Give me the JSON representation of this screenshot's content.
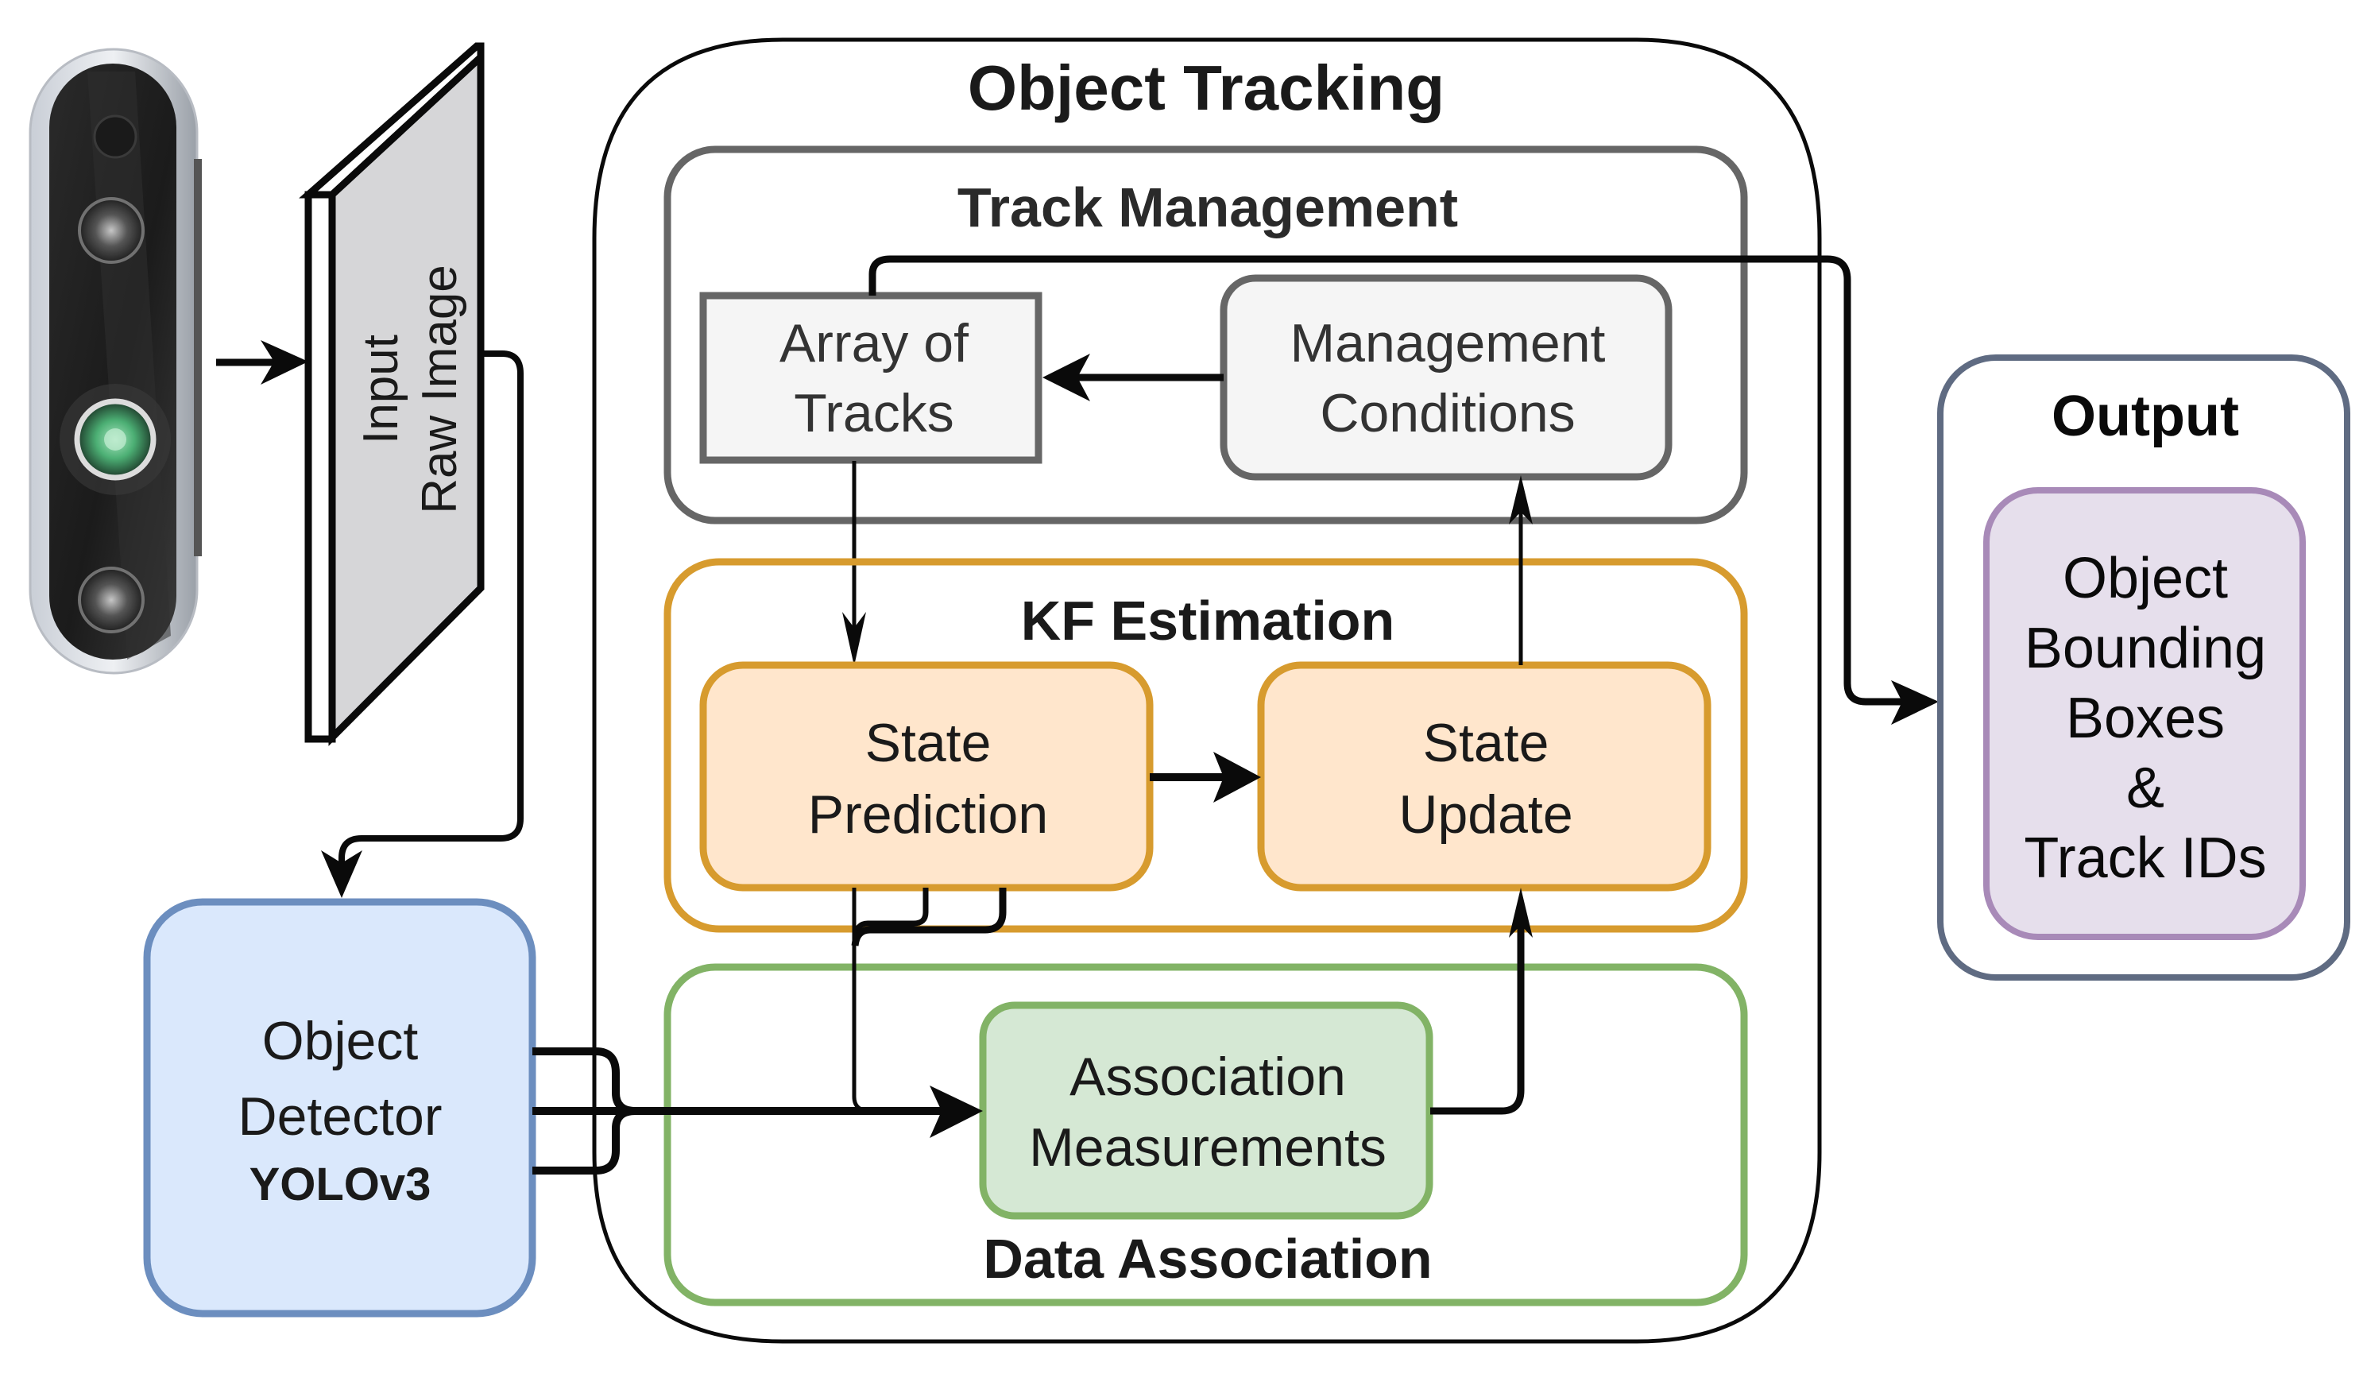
{
  "diagram": {
    "input": {
      "camera_icon": "depth-camera",
      "panel_line1": "Input",
      "panel_line2": "Raw Image"
    },
    "detector": {
      "line1": "Object",
      "line2": "Detector",
      "model": "YOLOv3",
      "fill": "#DAE8FC",
      "stroke": "#6C8EBF"
    },
    "object_tracking": {
      "title": "Object Tracking",
      "track_management": {
        "title": "Track Management",
        "stroke": "#666666",
        "array_of_tracks": {
          "line1": "Array of",
          "line2": "Tracks",
          "fill": "#F5F5F5"
        },
        "management_conditions": {
          "line1": "Management",
          "line2": "Conditions",
          "fill": "#F5F5F5"
        }
      },
      "kf_estimation": {
        "title": "KF Estimation",
        "stroke": "#D79B2E",
        "state_prediction": {
          "line1": "State",
          "line2": "Prediction",
          "fill": "#FFE6CC"
        },
        "state_update": {
          "line1": "State",
          "line2": "Update",
          "fill": "#FFE6CC"
        }
      },
      "data_association": {
        "title": "Data Association",
        "stroke": "#82B366",
        "association_measurements": {
          "line1": "Association",
          "line2": "Measurements",
          "fill": "#D5E8D4"
        }
      }
    },
    "output": {
      "title": "Output",
      "stroke": "#5F6B82",
      "result": {
        "line1": "Object",
        "line2": "Bounding",
        "line3": "Boxes",
        "line4": "&",
        "line5": "Track IDs",
        "fill": "#E6DFEC",
        "stroke": "#A88AB8"
      }
    },
    "connections": [
      {
        "from": "camera",
        "to": "input-raw-image"
      },
      {
        "from": "input-raw-image",
        "to": "object-detector"
      },
      {
        "from": "object-detector",
        "to": "association-measurements"
      },
      {
        "from": "management-conditions",
        "to": "array-of-tracks"
      },
      {
        "from": "array-of-tracks",
        "to": "state-prediction"
      },
      {
        "from": "state-prediction",
        "to": "state-update"
      },
      {
        "from": "state-prediction",
        "to": "association-measurements"
      },
      {
        "from": "association-measurements",
        "to": "state-update"
      },
      {
        "from": "state-update",
        "to": "management-conditions"
      },
      {
        "from": "array-of-tracks",
        "to": "output"
      }
    ]
  }
}
